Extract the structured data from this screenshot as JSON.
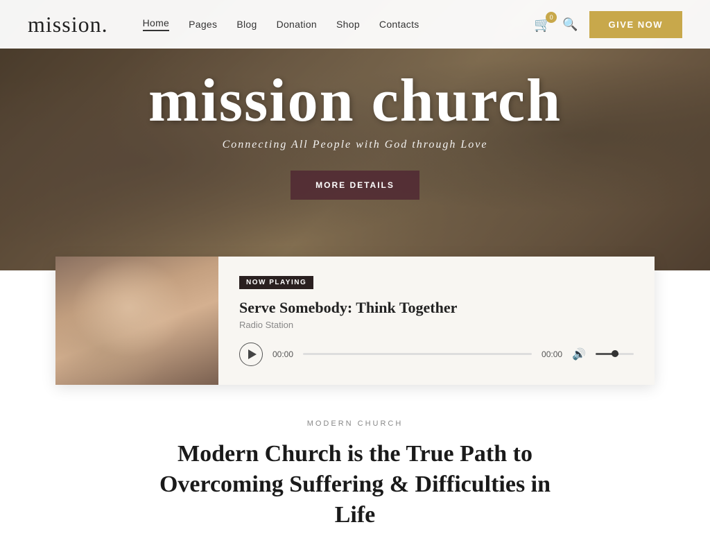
{
  "header": {
    "logo": "mission.",
    "nav": {
      "home": "Home",
      "pages": "Pages",
      "blog": "Blog",
      "donation": "Donation",
      "shop": "Shop",
      "contacts": "Contacts"
    },
    "cart_count": "0",
    "give_now": "GIVE NOW"
  },
  "hero": {
    "title": "mission church",
    "subtitle": "Connecting All People with God through Love",
    "cta": "MORE DETAILS"
  },
  "audio_player": {
    "badge": "NOW PLAYING",
    "title": "Serve Somebody: Think Together",
    "subtitle": "Radio Station",
    "time_current": "00:00",
    "time_total": "00:00",
    "progress": 0
  },
  "bottom": {
    "label": "MODERN CHURCH",
    "title": "Modern Church is the True Path to Overcoming Suffering & Difficulties in Life"
  }
}
